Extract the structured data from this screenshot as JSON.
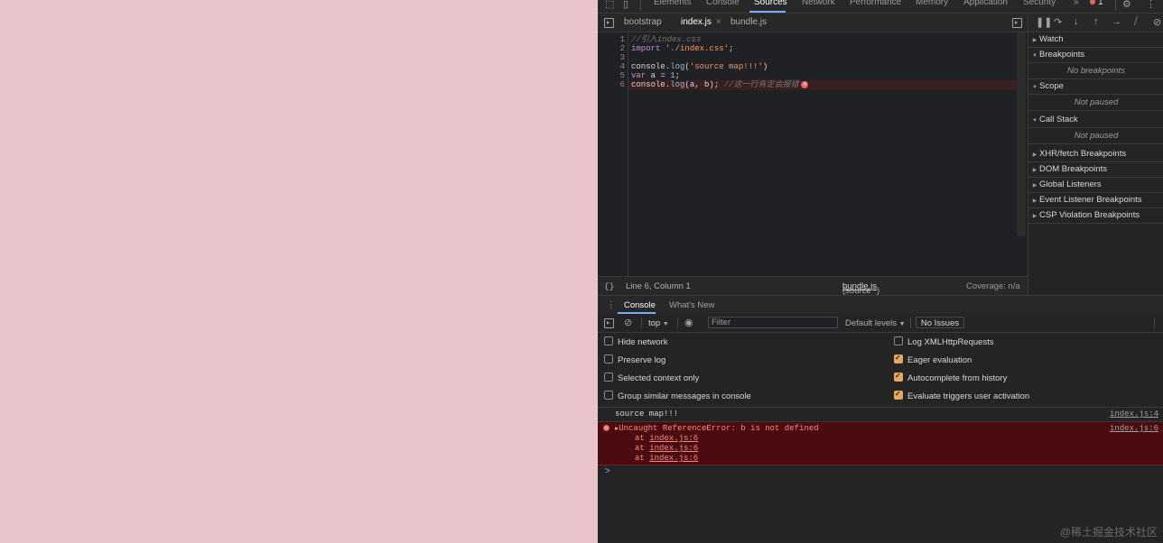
{
  "devtools": {
    "main_tabs": [
      "Elements",
      "Console",
      "Sources",
      "Network",
      "Performance",
      "Memory",
      "Application",
      "Security"
    ],
    "more_tabs": "»",
    "error_count": "1",
    "source_tabs": {
      "bootstrap": "bootstrap",
      "index": "index.js",
      "bundle": "bundle.js",
      "close_glyph": "×"
    },
    "code_lines": [
      {
        "num": "1",
        "comment": "//引入index.css"
      },
      {
        "num": "2",
        "kw": "import",
        "str": "'./index.css'",
        "tail": ";"
      },
      {
        "num": "3"
      },
      {
        "num": "4",
        "obj": "console.",
        "fn": "log",
        "open": "(",
        "str": "'source map!!!'",
        "tail": ")"
      },
      {
        "num": "5",
        "kw": "var",
        "mid": " a = ",
        "numv": "1",
        "tail": ";"
      },
      {
        "num": "6",
        "obj": "console.",
        "fn": "log",
        "args": "(a, b); ",
        "comment": "//这一行肯定会报错"
      }
    ],
    "status": {
      "position": "Line 6, Column 1",
      "mapped_prefix": "(source mapped from ",
      "mapped_file": "bundle.js",
      "mapped_suffix": ")",
      "coverage": "Coverage: n/a"
    },
    "sidebar": {
      "watch": "Watch",
      "breakpoints": "Breakpoints",
      "no_breakpoints": "No breakpoints",
      "scope": "Scope",
      "scope_state": "Not paused",
      "call_stack": "Call Stack",
      "call_stack_state": "Not paused",
      "xhr": "XHR/fetch Breakpoints",
      "dom": "DOM Breakpoints",
      "global": "Global Listeners",
      "event": "Event Listener Breakpoints",
      "csp": "CSP Violation Breakpoints"
    },
    "console": {
      "tab_console": "Console",
      "tab_whats_new": "What's New",
      "context": "top",
      "filter_placeholder": "Filter",
      "levels": "Default levels",
      "issues": "No Issues",
      "options_left": [
        {
          "label": "Hide network",
          "checked": false
        },
        {
          "label": "Preserve log",
          "checked": false
        },
        {
          "label": "Selected context only",
          "checked": false
        },
        {
          "label": "Group similar messages in console",
          "checked": false
        }
      ],
      "options_right": [
        {
          "label": "Log XMLHttpRequests",
          "checked": false
        },
        {
          "label": "Eager evaluation",
          "checked": true
        },
        {
          "label": "Autocomplete from history",
          "checked": true
        },
        {
          "label": "Evaluate triggers user activation",
          "checked": true
        }
      ],
      "log_message": "source map!!!",
      "log_source": "index.js:4",
      "error_message": "Uncaught ReferenceError: b is not defined",
      "error_source": "index.js:6",
      "stack_prefix": "at ",
      "stack": [
        "index.js:6",
        "index.js:6",
        "index.js:6"
      ],
      "prompt": ">"
    },
    "watermark": "@稀土掘金技术社区"
  },
  "colors": {
    "page_background": "#eac4cb",
    "devtools_background": "#242424",
    "accent": "#7cacf8",
    "error": "#e46962"
  }
}
